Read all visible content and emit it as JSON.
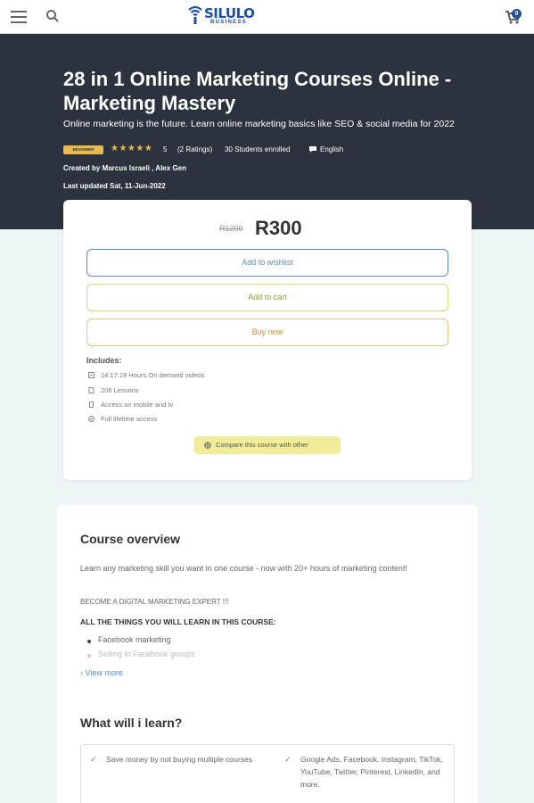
{
  "header": {
    "brand_name": "SILULO",
    "brand_sub": "BUSINESS",
    "cart_count": "0"
  },
  "course": {
    "title": "28 in 1 Online Marketing Courses Online - Marketing Mastery",
    "subtitle": "Online marketing is the future. Learn online marketing basics like SEO & social media for 2022",
    "level_badge": "BEGINNER",
    "stars": "★★★★★",
    "rating_value": "5",
    "rating_count": "(2 Ratings)",
    "students": "30 Students enrolled",
    "language": "English",
    "created_by": "Created by Marcus Israeli , Alex Gen",
    "last_updated": "Last updated Sat, 11-Jun-2022"
  },
  "purchase": {
    "old_price": "R1200",
    "price": "R300",
    "wishlist_label": "Add to wishlist",
    "cart_label": "Add to cart",
    "buy_label": "Buy now",
    "includes_title": "Includes:",
    "includes": [
      {
        "icon": "video-icon",
        "text": "14:17:19 Hours On demand videos"
      },
      {
        "icon": "document-icon",
        "text": "206 Lessons"
      },
      {
        "icon": "mobile-icon",
        "text": "Access on mobile and tv"
      },
      {
        "icon": "infinity-icon",
        "text": "Full lifetime access"
      }
    ],
    "compare_label": "Compare this course with other"
  },
  "overview": {
    "title": "Course overview",
    "description": "Learn any marketing skill you want in one course - now with 20+ hours of marketing content!",
    "expert_line": "BECOME A DIGITAL MARKETING EXPERT !!!",
    "things_heading": "ALL THE THINGS YOU WILL LEARN IN THIS COURSE:",
    "list": [
      "Facebook marketing",
      "Selling in Facebook groups"
    ],
    "view_more": "View more"
  },
  "learn": {
    "title": "What will i learn?",
    "items": [
      "Save money by not buying multiple courses",
      "Google Ads, Facebook, Instagram, TikTok, YouTube, Twitter, Pinterest, LinkedIn, and more."
    ]
  },
  "colors": {
    "hero_bg": "#2c333f",
    "brand_blue": "#1e4fa3",
    "badge_yellow": "#e9b949",
    "compare_bg": "#f0ec99"
  }
}
